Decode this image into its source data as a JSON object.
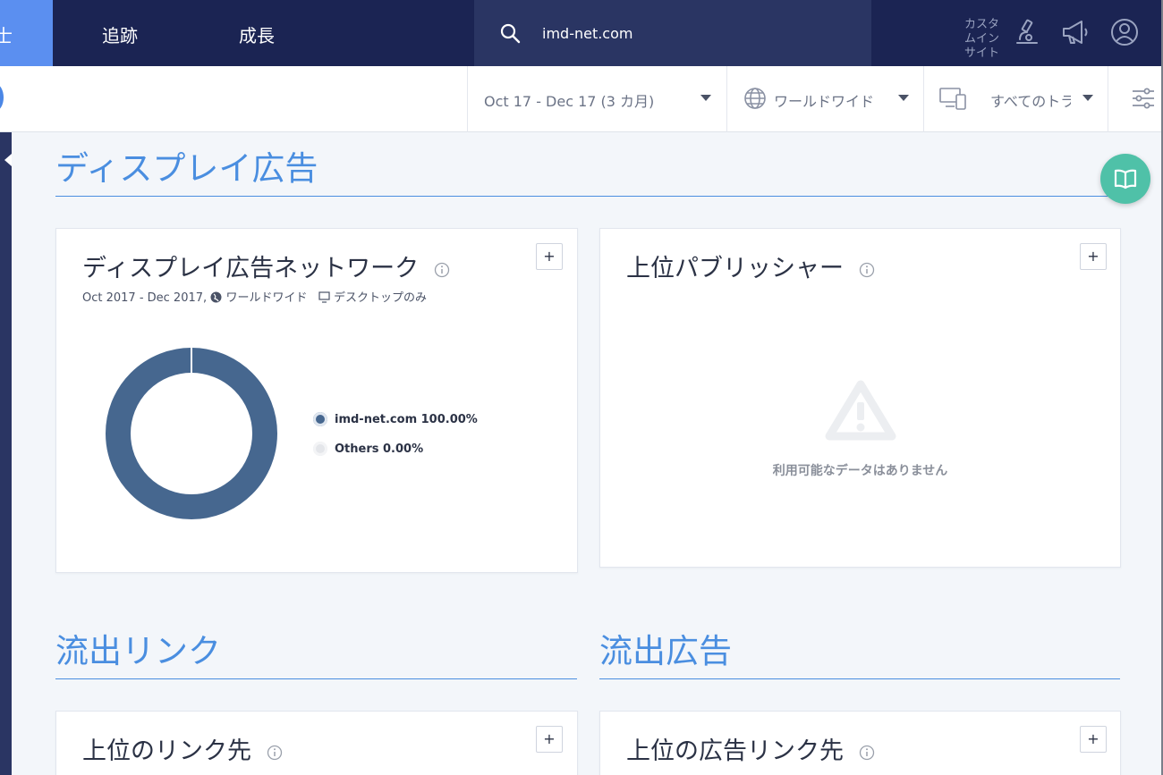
{
  "topnav": {
    "active_tab_stub": "士",
    "tabs": [
      {
        "label": "追跡"
      },
      {
        "label": "成長"
      }
    ],
    "search": {
      "value": "imd-net.com",
      "icon": "search-icon"
    },
    "custom_insight": "カスタムインサイト",
    "icons": [
      "microscope-icon",
      "megaphone-icon",
      "user-icon"
    ]
  },
  "filterbar": {
    "date_range": "Oct 17 - Dec 17 (3 カ月)",
    "region": "ワールドワイド",
    "traffic": "すべてのトラ",
    "icons": [
      "globe-icon",
      "device-icon",
      "settings-icon"
    ]
  },
  "sections": {
    "display_ads": {
      "title": "ディスプレイ広告"
    },
    "outgoing_links": {
      "title": "流出リンク"
    },
    "outgoing_ads": {
      "title": "流出広告"
    }
  },
  "cards": {
    "ad_network": {
      "title": "ディスプレイ広告ネットワーク",
      "add_label": "+",
      "subtitle_date": "Oct 2017 - Dec 2017,",
      "subtitle_region": "ワールドワイド",
      "subtitle_device": "デスクトップのみ",
      "legend": [
        {
          "label": "imd-net.com 100.00%",
          "color": "#46678f"
        },
        {
          "label": "Others 0.00%",
          "color": "#e4e6ea"
        }
      ]
    },
    "top_publishers": {
      "title": "上位パブリッシャー",
      "add_label": "+",
      "no_data": "利用可能なデータはありません"
    },
    "top_link_destinations": {
      "title": "上位のリンク先",
      "add_label": "+"
    },
    "top_ad_destinations": {
      "title": "上位の広告リンク先",
      "add_label": "+"
    }
  },
  "chart_data": {
    "type": "pie",
    "categories": [
      "imd-net.com",
      "Others"
    ],
    "values": [
      100.0,
      0.0
    ],
    "colors": [
      "#46678f",
      "#e4e6ea"
    ],
    "donut": true,
    "legend_position": "right"
  },
  "fab": {
    "icon": "book-icon"
  }
}
